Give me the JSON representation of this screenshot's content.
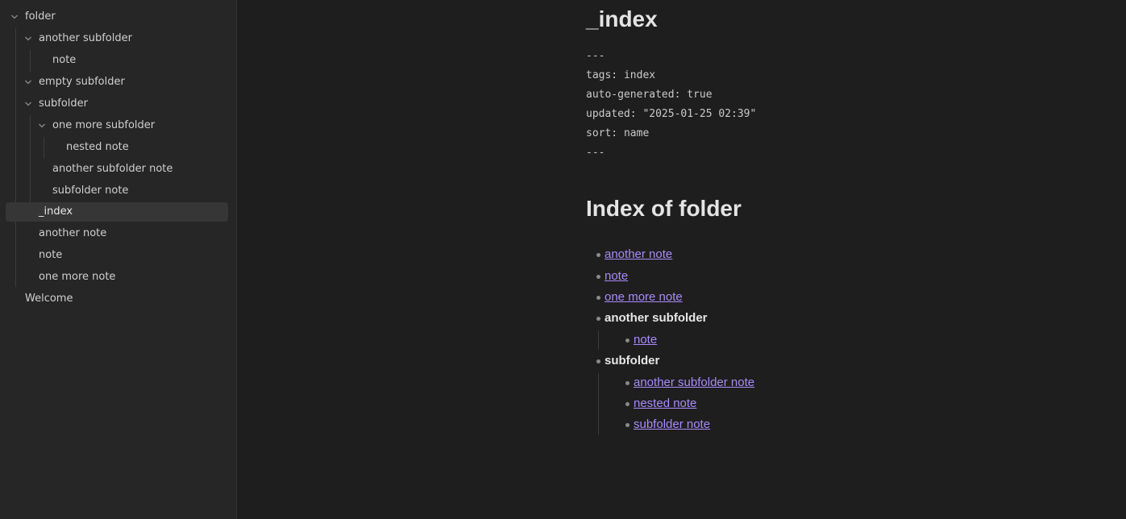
{
  "sidebar": {
    "items": [
      {
        "label": "folder"
      },
      {
        "label": "another subfolder"
      },
      {
        "label": "note"
      },
      {
        "label": "empty subfolder"
      },
      {
        "label": "subfolder"
      },
      {
        "label": "one more subfolder"
      },
      {
        "label": "nested note"
      },
      {
        "label": "another subfolder note"
      },
      {
        "label": "subfolder note"
      },
      {
        "label": "_index"
      },
      {
        "label": "another note"
      },
      {
        "label": "note"
      },
      {
        "label": "one more note"
      },
      {
        "label": "Welcome"
      }
    ]
  },
  "doc": {
    "title": "_index",
    "frontmatter": {
      "open": "---",
      "tags": "tags: index",
      "auto_generated": "auto-generated: true",
      "updated": "updated: \"2025-01-25 02:39\"",
      "sort": "sort: name",
      "close": "---"
    },
    "heading": "Index of folder",
    "list": [
      {
        "label": "another note"
      },
      {
        "label": "note"
      },
      {
        "label": "one more note"
      },
      {
        "label": "another subfolder"
      },
      {
        "label": "note"
      },
      {
        "label": "subfolder"
      },
      {
        "label": "another subfolder note"
      },
      {
        "label": "nested note"
      },
      {
        "label": "subfolder note"
      }
    ]
  },
  "colors": {
    "background": "#1e1e1e",
    "sidebar": "#262626",
    "link": "#a88bfa",
    "active_item": "#363636"
  }
}
